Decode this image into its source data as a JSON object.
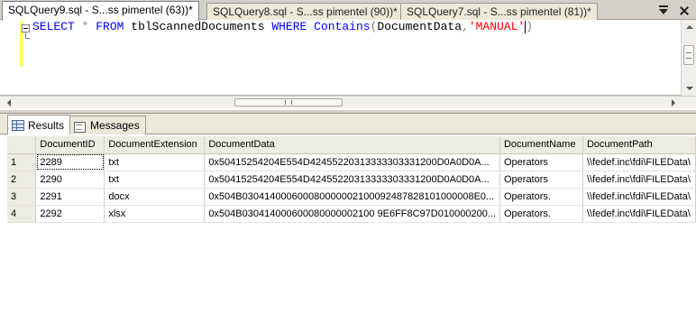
{
  "tabs": [
    {
      "label": "SQLQuery9.sql - S...ss pimentel (63))*",
      "active": true
    },
    {
      "label": "SQLQuery8.sql - S...ss pimentel (90))*",
      "active": false
    },
    {
      "label": "SQLQuery7.sql - S...ss pimentel (81))*",
      "active": false
    }
  ],
  "editor": {
    "tokens": {
      "select": "SELECT",
      "star": "*",
      "from": "FROM",
      "table": "tblScannedDocuments",
      "where": "WHERE",
      "contains": "Contains",
      "paren_open": "(",
      "column": "DocumentData",
      "comma": ",",
      "string": "'MANUAL'",
      "paren_close": ")"
    }
  },
  "result_tabs": {
    "results": "Results",
    "messages": "Messages"
  },
  "grid": {
    "columns": [
      "",
      "DocumentID",
      "DocumentExtension",
      "DocumentData",
      "DocumentName",
      "DocumentPath"
    ],
    "rows": [
      [
        "1",
        "2289",
        "txt",
        "0x50415254204E554D42455220313333303331200D0A0D0A...",
        "Operators",
        "\\\\fedef.inc\\fdi\\FILEData\\"
      ],
      [
        "2",
        "2290",
        "txt",
        "0x50415254204E554D42455220313333303331200D0A0D0A...",
        "Operators",
        "\\\\fedef.inc\\fdi\\FILEData\\"
      ],
      [
        "3",
        "2291",
        "docx",
        "0x504B030414000600080000002100092487828101000008E0...",
        "Operators.",
        "\\\\fedef.inc\\fdi\\FILEData\\"
      ],
      [
        "4",
        "2292",
        "xlsx",
        "0x504B030414000600080000002100 9E6FF8C97D010000200...",
        "Operators.",
        "\\\\fedef.inc\\fdi\\FILEData\\"
      ]
    ]
  }
}
